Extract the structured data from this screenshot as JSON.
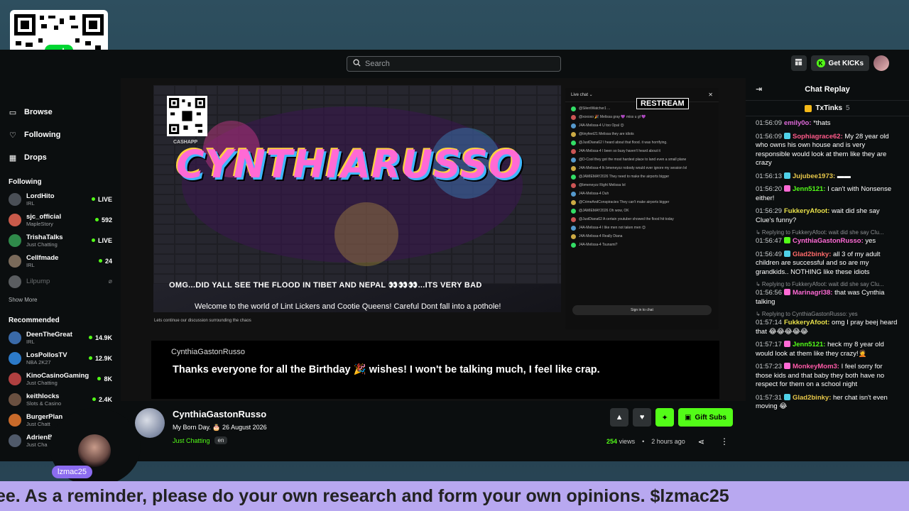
{
  "topbar": {
    "search_placeholder": "Search",
    "kicks_label": "Get KICKs",
    "kicks_logo": "K"
  },
  "qr_logo": "$",
  "sidebar": {
    "nav": [
      {
        "label": "Browse",
        "icon": "browse-icon"
      },
      {
        "label": "Following",
        "icon": "heart-icon"
      },
      {
        "label": "Drops",
        "icon": "drops-icon"
      }
    ],
    "following_title": "Following",
    "following": [
      {
        "name": "LordHito",
        "category": "IRL",
        "status": "LIVE",
        "color": "#4a4f56"
      },
      {
        "name": "sjc_official",
        "category": "MapleStory",
        "status": "592",
        "color": "#c85a4a"
      },
      {
        "name": "TrishaTalks",
        "category": "Just Chatting",
        "status": "LIVE",
        "color": "#2f8a4a"
      },
      {
        "name": "Cellfmade",
        "category": "IRL",
        "status": "24",
        "color": "#7a6a5a"
      },
      {
        "name": "Lilpump",
        "category": "",
        "status": "",
        "color": "#5a5d60",
        "offline": true
      }
    ],
    "show_more": "Show More",
    "recommended_title": "Recommended",
    "recommended": [
      {
        "name": "DeenTheGreat",
        "category": "IRL",
        "status": "14.9K",
        "color": "#3a6aa8"
      },
      {
        "name": "LosPollosTV",
        "category": "NBA 2K27",
        "status": "12.9K",
        "color": "#2c7ac8"
      },
      {
        "name": "KinoCasinoGaming",
        "category": "Just Chatting",
        "status": "8K",
        "color": "#b04040"
      },
      {
        "name": "keithlocks",
        "category": "Slots & Casino",
        "status": "2.4K",
        "color": "#6a5040"
      },
      {
        "name": "BurgerPlan",
        "category": "Just Chatt",
        "status": "",
        "color": "#c86a2a"
      },
      {
        "name": "AdrienB",
        "category": "Just Cha",
        "status": "",
        "color": "#505a6a"
      }
    ]
  },
  "video": {
    "graffiti_text": "CYNTHIARUSSO",
    "cashapp_label": "CASHAPP",
    "ticker": "OMG...DID YALL SEE THE FLOOD IN TIBET AND NEPAL 👀👀👀...ITS VERY BAD",
    "welcome": "Welcome to the world of Lint Lickers and Cootie Queens!  Careful Dont fall into a pothole!",
    "yt_below": "Lets continue our discussion surrounding the chaos",
    "yt_chat_title": "Live chat ⌄",
    "yt_chat_close": "✕",
    "restream": "RESTREAM",
    "yt_signin": "Sign in to chat",
    "yt_messages": [
      "@SilentWatcher1 ...",
      "@xoxoxo 🎉 Melissa gray 💜 miss u gf 💜",
      "J4A-Melissa-4  U too Opal 😊",
      "@tinyfeet21 Melissa they are idiots",
      "@JustDiana62 I heard about that flood. it was horrifying.",
      "J4A-Melissa-4  I been so busy haven't heard about it",
      "@D-Cool they got the most hardest place to land even a small plane",
      "J4A-Melissa-4  lk bmeneyzz nobody would ever ignore my session lol",
      "@JAMIEMAY2026  They need to make the airports bigger",
      "@bmeneyzz Right Melissa lol",
      "J4A-Melissa-4  Duh",
      "@CrimeAndConspiracies  They can't make airports bigger",
      "@JAMIEMAY2026  Oh wow, OK",
      "@JustDiana62 A certain youtuber showed the flood hit today",
      "J4A-Melissa-4  I like men not taken men 😊",
      "J4A-Melissa-4  Really Diana",
      "J4A-Melissa-4  Tsunami?"
    ]
  },
  "caption": {
    "name": "CynthiaGastonRusso",
    "text": "Thanks everyone for all the Birthday 🎉 wishes! I won't be talking much, I feel like crap."
  },
  "stream": {
    "streamer": "CynthiaGastonRusso",
    "title": "My Born Day. 🎂 26 August 2026",
    "category": "Just Chatting",
    "language": "en",
    "gift_label": "Gift Subs",
    "views_count": "254",
    "views_label": "views",
    "time_ago": "2 hours ago"
  },
  "chat": {
    "title": "Chat Replay",
    "pinned_user": "TxTinks",
    "pinned_count": "5",
    "messages": [
      {
        "time": "01:56:09",
        "user": "emily0o:",
        "color": "#e06adb",
        "text": " *thats",
        "badge": ""
      },
      {
        "time": "01:56:09",
        "user": "Sophiagrace62:",
        "color": "#ff5a8a",
        "text": " My 28 year old who owns his own house and is very responsible would look at them like they are crazy",
        "badge": "#4fd1e8"
      },
      {
        "time": "01:56:13",
        "user": "Jujubee1973:",
        "color": "#e8c84a",
        "text": " ▬▬",
        "badge": "#4fd1e8"
      },
      {
        "time": "01:56:20",
        "user": "Jenn5121:",
        "color": "#53fc18",
        "text": " I can't with Nonsense either!",
        "badge": "#ff6ad5"
      },
      {
        "time": "01:56:29",
        "user": "FukkeryAfoot:",
        "color": "#e8e04a",
        "text": " wait did she say Clue's funny?",
        "badge": ""
      },
      {
        "reply": "↳ Replying to FukkeryAfoot: wait did she say Clu..."
      },
      {
        "time": "01:56:47",
        "user": "CynthiaGastonRusso:",
        "color": "#ff6ad5",
        "text": " yes",
        "badge": "#53fc18"
      },
      {
        "time": "01:56:49",
        "user": "Glad2binky:",
        "color": "#ff6a6a",
        "text": " all 3 of my adult children are successful and so are my grandkids.. NOTHING like these idiots",
        "badge": "#4fd1e8"
      },
      {
        "reply": "↳ Replying to FukkeryAfoot: wait did she say Clu..."
      },
      {
        "time": "01:56:56",
        "user": "Marinagrl38:",
        "color": "#ff6ad5",
        "text": " that was Cynthia talking",
        "badge": "#ff6ad5"
      },
      {
        "reply": "↳ Replying to CynthiaGastonRusso: yes"
      },
      {
        "time": "01:57:14",
        "user": "FukkeryAfoot:",
        "color": "#e8e04a",
        "text": " omg I pray beej heard that 😂😂😂😂😂",
        "badge": ""
      },
      {
        "time": "01:57:17",
        "user": "Jenn5121:",
        "color": "#53fc18",
        "text": " heck my 8 year old would look at them like they crazy!🤦",
        "badge": "#ff6ad5"
      },
      {
        "time": "01:57:23",
        "user": "MonkeyMom3:",
        "color": "#ff5aa8",
        "text": " I feel sorry for those kids and that baby they both have no respect for them on a school night",
        "badge": "#ff6ad5"
      },
      {
        "time": "01:57:31",
        "user": "Glad2binky:",
        "color": "#e8c84a",
        "text": " her chat isn't even moving 😂",
        "badge": "#4fd1e8"
      }
    ]
  },
  "marquee": "ee. As a reminder, please do your own research and form your own opinions. $lzmac25",
  "webcam_tag": "lzmac25",
  "colors": {
    "accent": "#53fc18",
    "marquee_bg": "#b8a8f0",
    "tag_bg": "#8c6cf0"
  }
}
